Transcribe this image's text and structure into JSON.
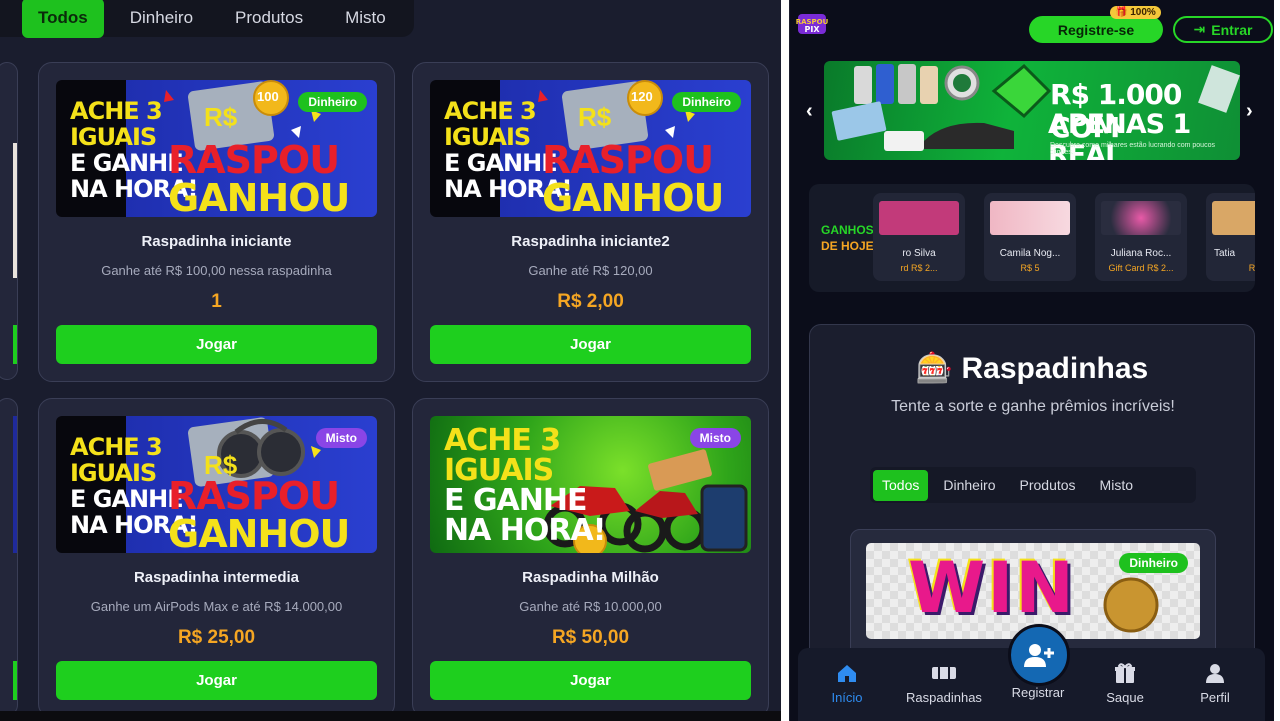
{
  "left_panel": {
    "tabs": [
      "Todos",
      "Dinheiro",
      "Produtos",
      "Misto"
    ],
    "active_tab": "Todos",
    "cards": [
      {
        "banner_line1": "ACHE 3",
        "banner_line2": "IGUAIS",
        "banner_line3": "E GANHE",
        "banner_line4": "NA HORA!",
        "banner_raspou": "RASPOU",
        "banner_ganhou": "GANHOU",
        "banner_rs": "R$",
        "coin": "100",
        "badge": "Dinheiro",
        "badge_color": "#1ec11e",
        "name": "Raspadinha iniciante",
        "description": "Ganhe até R$ 100,00 nessa raspadinha",
        "price": "1",
        "button": "Jogar"
      },
      {
        "banner_line1": "ACHE 3",
        "banner_line2": "IGUAIS",
        "banner_line3": "E GANHE",
        "banner_line4": "NA HORA!",
        "banner_raspou": "RASPOU",
        "banner_ganhou": "GANHOU",
        "banner_rs": "R$",
        "coin": "120",
        "badge": "Dinheiro",
        "badge_color": "#1ec11e",
        "name": "Raspadinha iniciante2",
        "description": "Ganhe até R$ 120,00",
        "price": "R$ 2,00",
        "button": "Jogar"
      },
      {
        "banner_line1": "ACHE 3",
        "banner_line2": "IGUAIS",
        "banner_line3": "E GANHE",
        "banner_line4": "NA HORA!",
        "banner_raspou": "RASPOU",
        "banner_ganhou": "GANHOU",
        "banner_rs": "R$",
        "badge": "Misto",
        "badge_color": "#8a45e6",
        "name": "Raspadinha intermedia",
        "description": "Ganhe um AirPods Max e até R$ 14.000,00",
        "price": "R$ 25,00",
        "button": "Jogar"
      },
      {
        "banner_line1": "ACHE 3",
        "banner_line2": "IGUAIS",
        "banner_line3": "E GANHE",
        "banner_line4": "NA HORA!",
        "badge": "Misto",
        "badge_color": "#8a45e6",
        "name": "Raspadinha Milhão",
        "description": "Ganhe até R$ 10.000,00",
        "price": "R$ 50,00",
        "button": "Jogar"
      }
    ]
  },
  "right_panel": {
    "logo_text": "RASPOU PIX",
    "register_button": "Registre-se",
    "register_badge": "100%",
    "login_button": "Entrar",
    "carousel": {
      "line1": "R$ 1.000 COM",
      "line2": "APENAS 1 REAL",
      "sub": "Descubra como milhares estão lucrando com poucos cliques."
    },
    "winners": {
      "title_line1": "GANHOS",
      "title_line2": "DE HOJE",
      "items": [
        {
          "name": "ro Silva",
          "prize": "rd R$ 2..."
        },
        {
          "name": "Camila Nog...",
          "prize": "R$ 5"
        },
        {
          "name": "Juliana Roc...",
          "prize": "Gift Card R$ 2..."
        },
        {
          "name": "Tatia",
          "prize": "R"
        }
      ]
    },
    "raspadinhas": {
      "title": "Raspadinhas",
      "subtitle": "Tente a sorte e ganhe prêmios incríveis!",
      "tabs": [
        "Todos",
        "Dinheiro",
        "Produtos",
        "Misto"
      ],
      "active_tab": "Todos",
      "card_banner_text": "WIN",
      "card_badge": "Dinheiro"
    },
    "bottom_nav": [
      {
        "label": "Início",
        "icon": "home-icon",
        "active": true
      },
      {
        "label": "Raspadinhas",
        "icon": "ticket-icon",
        "active": false
      },
      {
        "label": "Registrar",
        "icon": "add-user-icon",
        "active": false
      },
      {
        "label": "Saque",
        "icon": "gift-icon",
        "active": false
      },
      {
        "label": "Perfil",
        "icon": "user-icon",
        "active": false
      }
    ]
  },
  "colors": {
    "accent_green": "#1ec11e",
    "price_orange": "#f5a623",
    "background": "#1a1d2e",
    "active_blue": "#2f8cf0"
  }
}
